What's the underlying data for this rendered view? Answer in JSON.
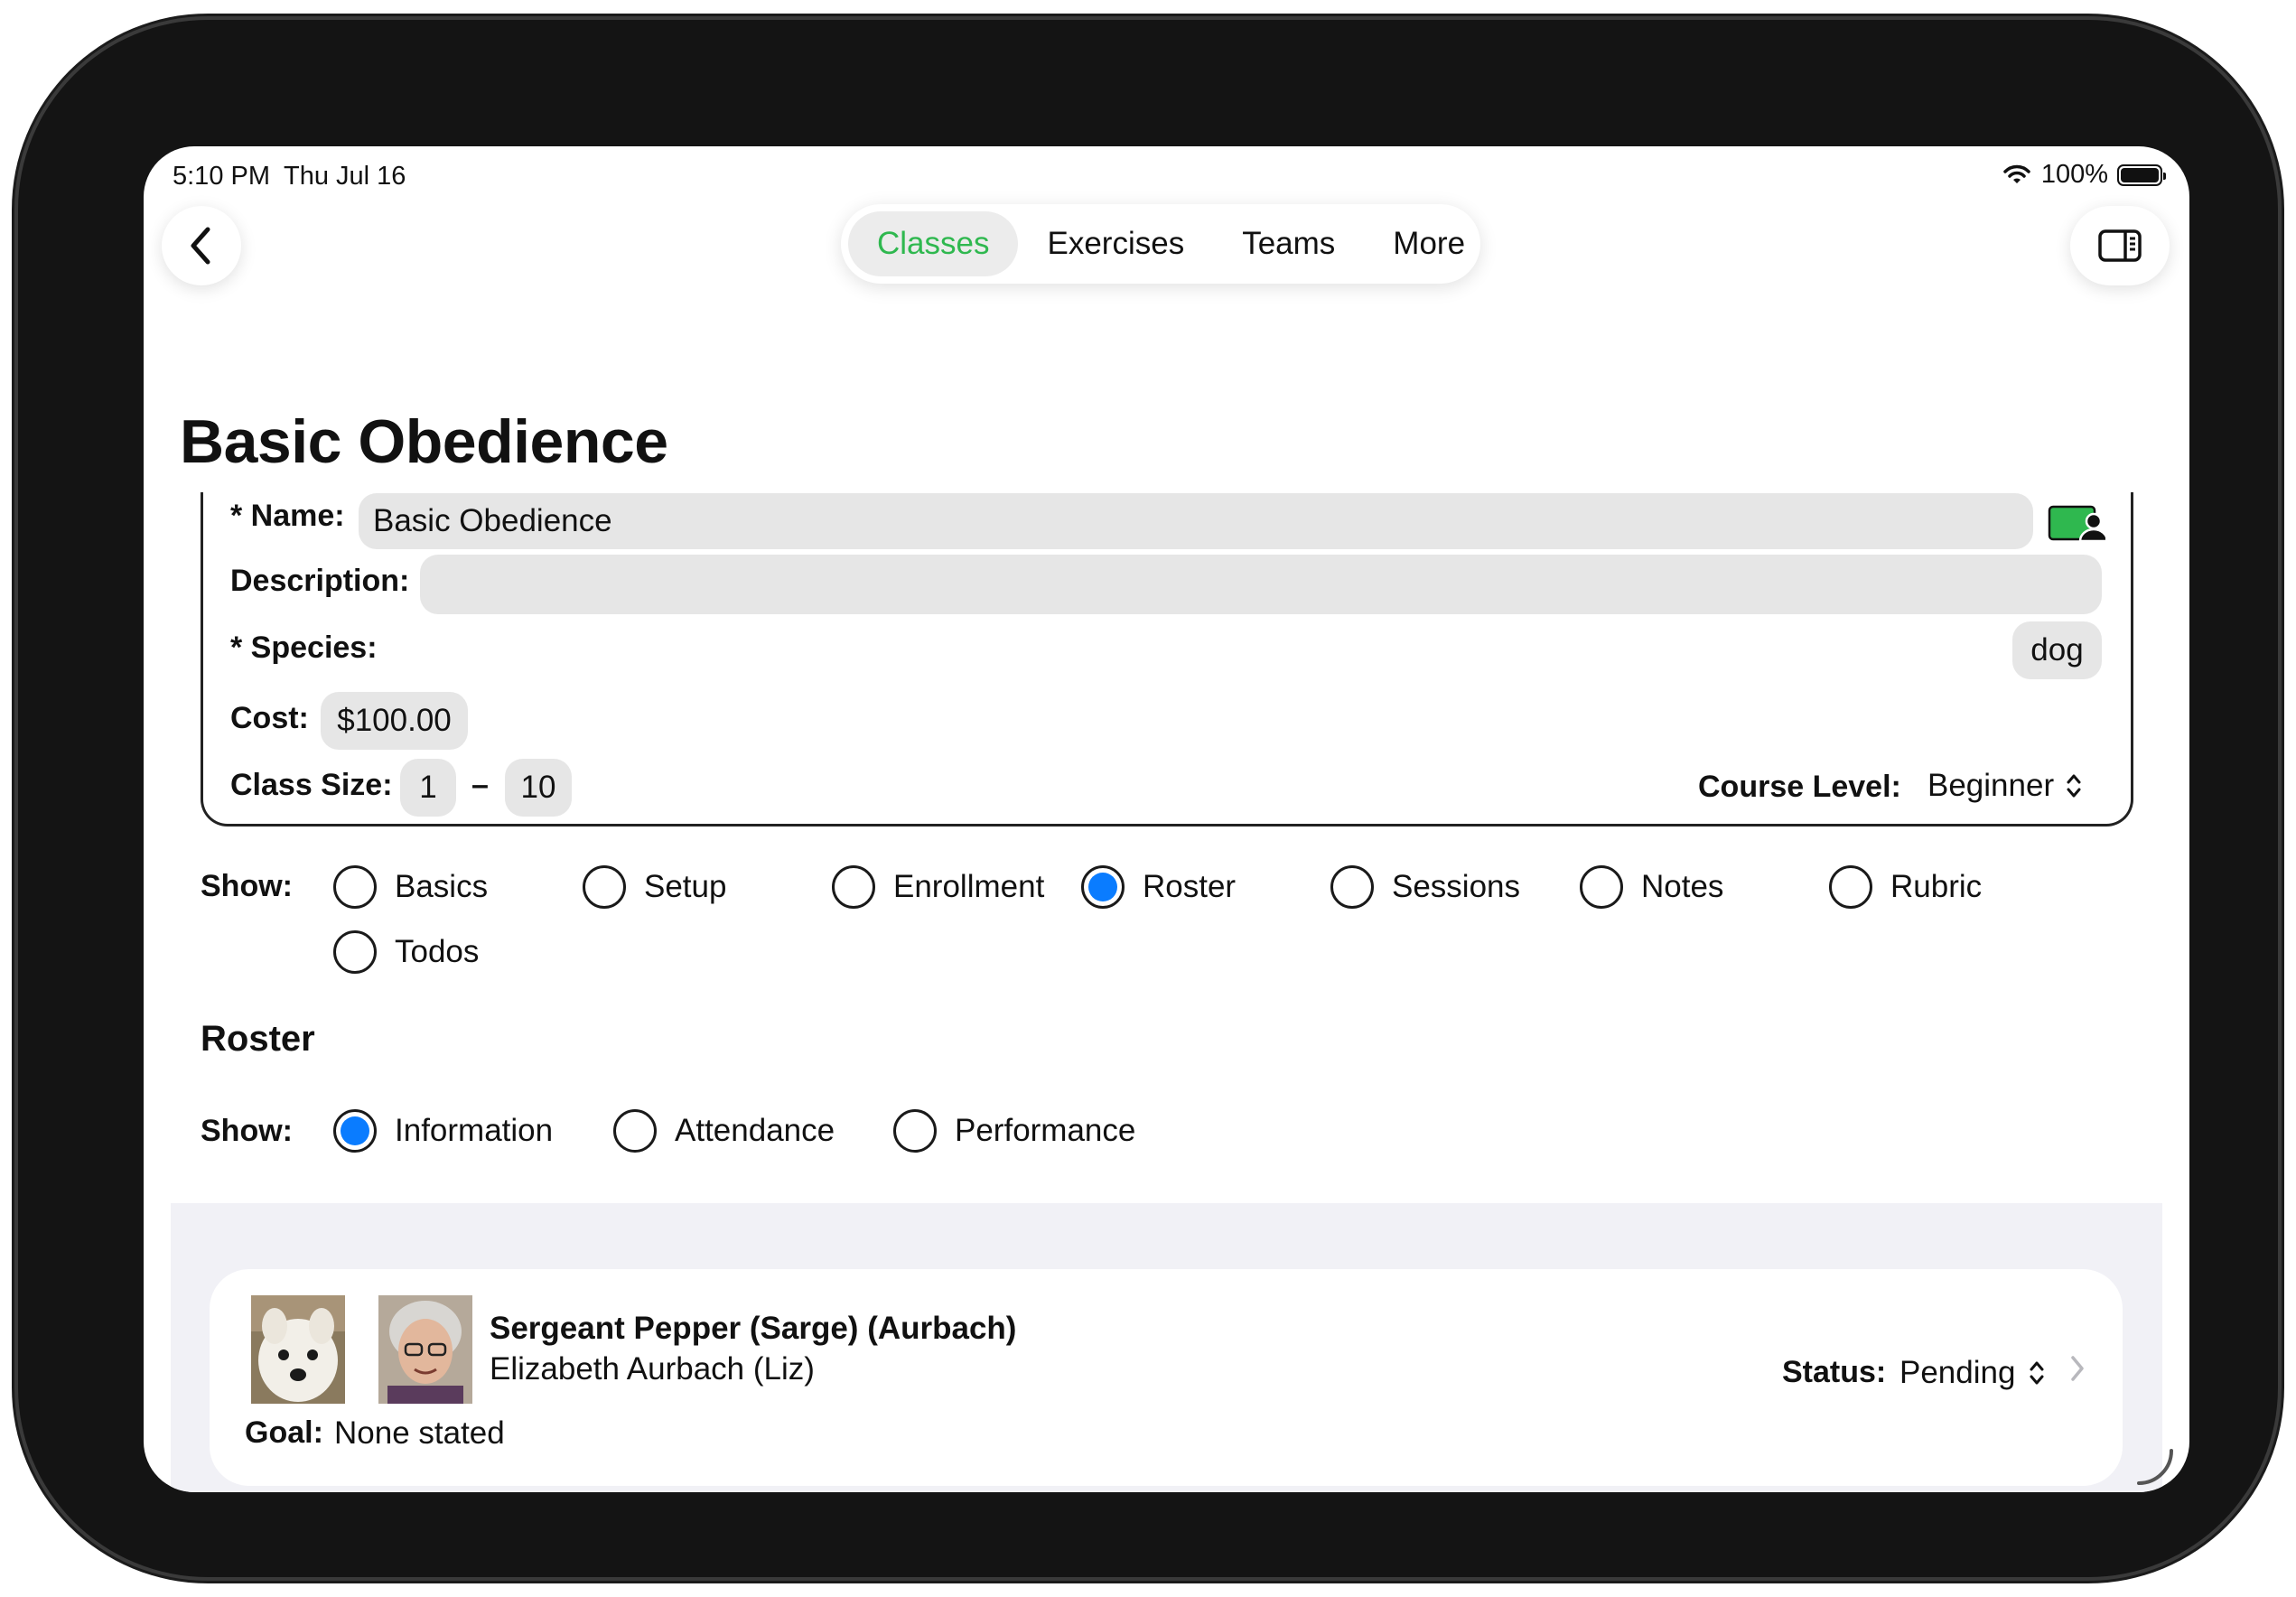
{
  "status_bar": {
    "time": "5:10 PM",
    "date": "Thu Jul 16",
    "battery": "100%"
  },
  "nav": {
    "tabs": [
      {
        "label": "Classes",
        "active": true
      },
      {
        "label": "Exercises",
        "active": false
      },
      {
        "label": "Teams",
        "active": false
      },
      {
        "label": "More",
        "active": false
      }
    ]
  },
  "page": {
    "title": "Basic Obedience"
  },
  "form": {
    "name_label": "* Name:",
    "name_value": "Basic Obedience",
    "description_label": "Description:",
    "description_value": "",
    "species_label": "* Species:",
    "species_value": "dog",
    "cost_label": "Cost:",
    "cost_value": "$100.00",
    "class_size_label": "Class Size:",
    "class_size_min": "1",
    "class_size_sep": "–",
    "class_size_max": "10",
    "course_level_label": "Course Level:",
    "course_level_value": "Beginner"
  },
  "show_sections": {
    "label": "Show:",
    "options": [
      "Basics",
      "Setup",
      "Enrollment",
      "Roster",
      "Sessions",
      "Notes",
      "Rubric",
      "Todos"
    ],
    "selected": "Roster"
  },
  "roster": {
    "title": "Roster",
    "show_label": "Show:",
    "options": [
      "Information",
      "Attendance",
      "Performance"
    ],
    "selected": "Information",
    "entries": [
      {
        "dog_name": "Sergeant Pepper (Sarge) (Aurbach)",
        "owner": "Elizabeth Aurbach  (Liz)",
        "goal_label": "Goal:",
        "goal": "None stated",
        "status_label": "Status:",
        "status": "Pending"
      }
    ]
  },
  "colors": {
    "accent_green": "#2fb84f",
    "radio_blue": "#0a7cff"
  }
}
